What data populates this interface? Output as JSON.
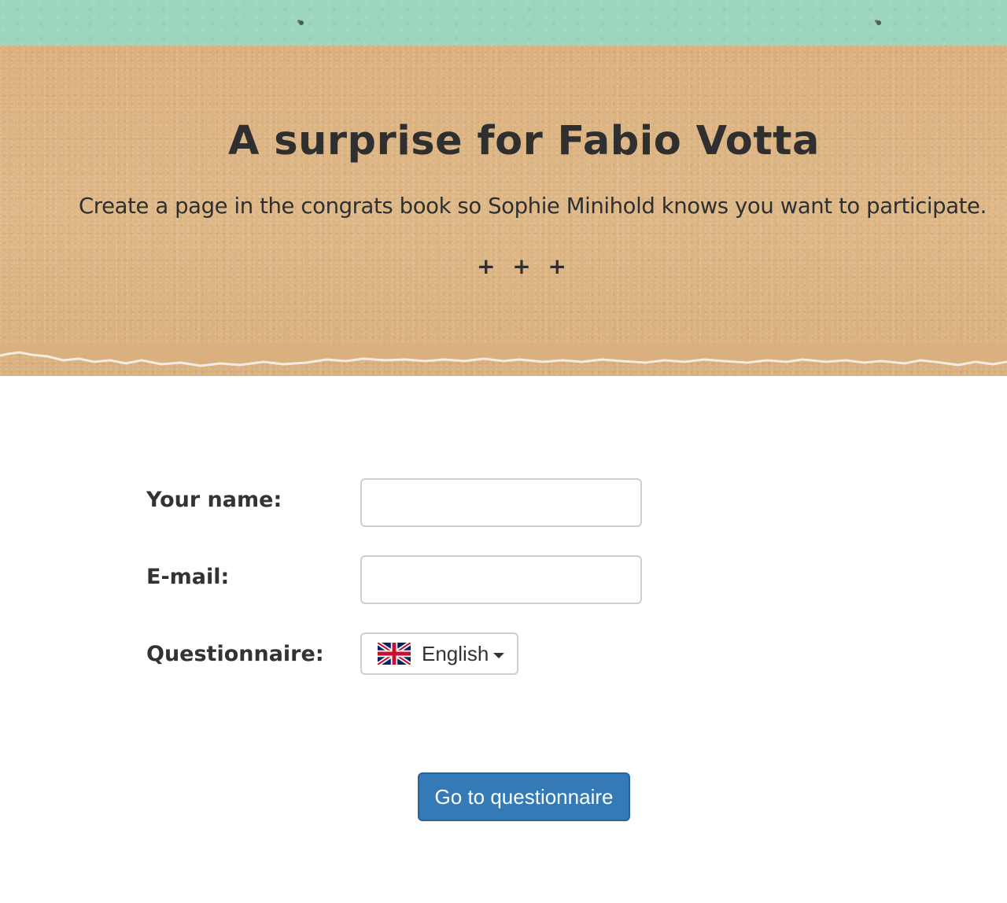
{
  "header": {
    "title": "A surprise for Fabio Votta",
    "subtitle": "Create a page in the congrats book so Sophie Minihold knows you want to participate.",
    "divider": "+ + +",
    "colors": {
      "strip": "#9dd6bd",
      "kraft": "#dcb382",
      "text": "#2f2f2f"
    }
  },
  "form": {
    "name_label": "Your name:",
    "name_value": "",
    "email_label": "E-mail:",
    "email_value": "",
    "questionnaire_label": "Questionnaire:",
    "language": {
      "selected": "English",
      "flag_icon": "uk-flag-icon"
    },
    "submit_label": "Go to questionnaire",
    "button_color": "#337ab7"
  }
}
